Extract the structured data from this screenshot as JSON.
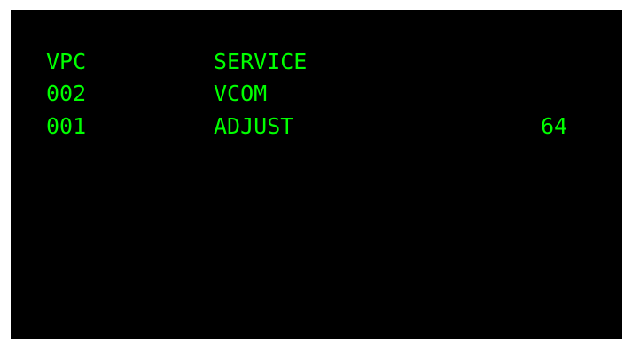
{
  "screen": {
    "text_color": "#00ff00",
    "background_color": "#000000",
    "header": {
      "code": "VPC",
      "name": "SERVICE"
    },
    "rows": [
      {
        "code": "002",
        "name": "VCOM",
        "value": ""
      },
      {
        "code": "001",
        "name": "ADJUST",
        "value": "64"
      }
    ]
  }
}
